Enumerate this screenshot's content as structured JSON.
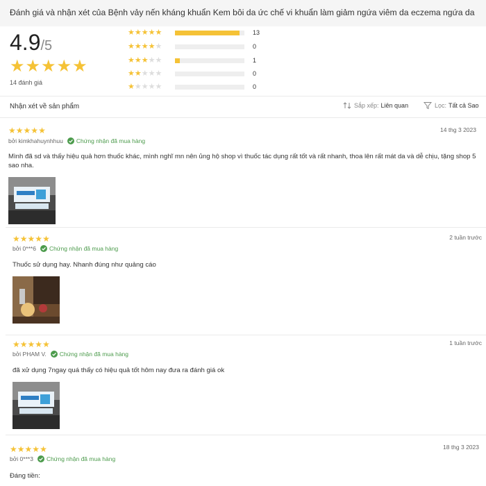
{
  "header": {
    "title": "Đánh giá và nhận xét của Bệnh vảy nến kháng khuẩn Kem bôi da ức chế vi khuẩn làm giảm ngứa viêm da eczema ngứa da"
  },
  "summary": {
    "score": "4.9",
    "score_max": "/5",
    "total_label": "14 đánh giá",
    "distribution": [
      {
        "stars": 5,
        "count": "13",
        "fraction": 0.93
      },
      {
        "stars": 4,
        "count": "0",
        "fraction": 0
      },
      {
        "stars": 3,
        "count": "1",
        "fraction": 0.07
      },
      {
        "stars": 2,
        "count": "0",
        "fraction": 0
      },
      {
        "stars": 1,
        "count": "0",
        "fraction": 0
      }
    ]
  },
  "toolbar": {
    "label": "Nhận xét về sản phẩm",
    "sort_label": "Sắp xếp:",
    "sort_value": "Liên quan",
    "filter_label": "Lọc:",
    "filter_value": "Tất cả Sao"
  },
  "colors": {
    "star": "#f5c236",
    "verified": "#4c9b4c"
  },
  "reviews": [
    {
      "rating": 5,
      "author": "bởi kimkhahuynhhuu",
      "verified": "Chứng nhận đã mua hàng",
      "date": "14 thg 3 2023",
      "text": "Mình đã sd và thấy hiệu quả hơn thuốc khác, mình nghĩ mn nên ủng hộ shop vì thuốc tác dụng rất tốt và rất nhanh, thoa lên rất mát da và dễ chịu, tặng shop 5 sao nha.",
      "photo": "product-box-photo"
    },
    {
      "rating": 5,
      "author": "bởi 0***6",
      "verified": "Chứng nhận đã mua hàng",
      "date": "2 tuần trước",
      "text": "Thuốc sử dụng hay. Nhanh đúng như quảng cáo",
      "photo": "room-photo"
    },
    {
      "rating": 5,
      "author": "bởi PHAM V.",
      "verified": "Chứng nhận đã mua hàng",
      "date": "1 tuần trước",
      "text": "đã xử dụng 7ngay quá thấy có hiệu quả tốt hôm nay đưa ra đánh giá ok",
      "photo": "product-box-photo"
    },
    {
      "rating": 5,
      "author": "bởi 0***3",
      "verified": "Chứng nhận đã mua hàng",
      "date": "18 thg 3 2023",
      "text": "Đáng tiền:",
      "photo": ""
    }
  ]
}
